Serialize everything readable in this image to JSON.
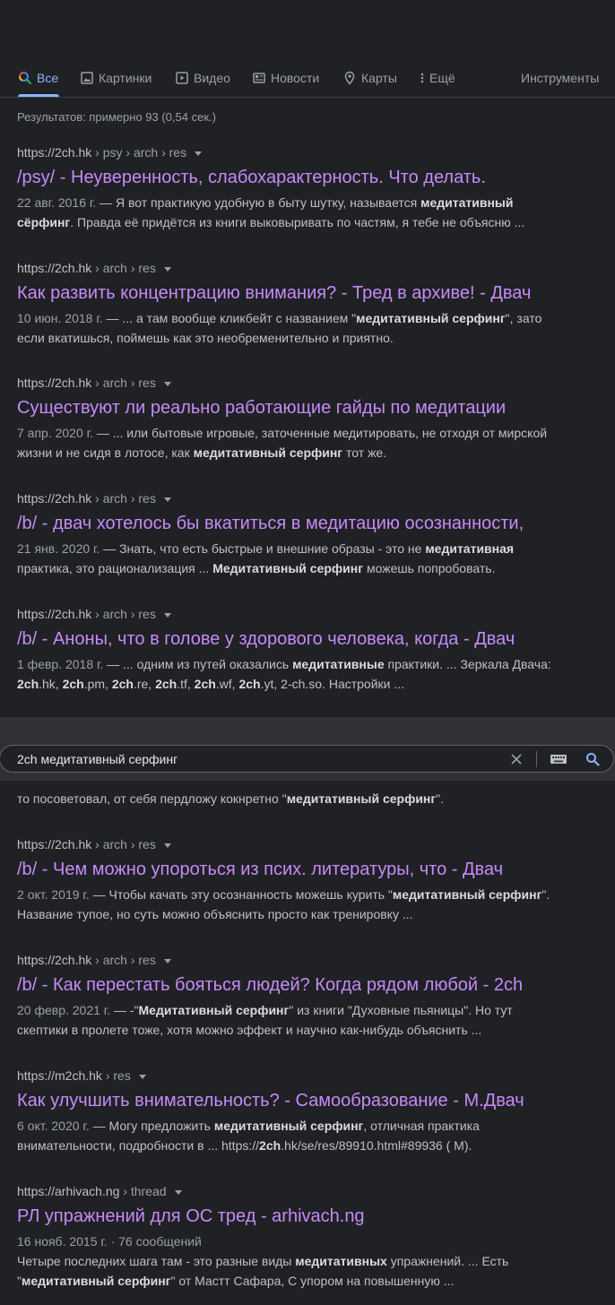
{
  "tabs": {
    "all": "Все",
    "images": "Картинки",
    "video": "Видео",
    "news": "Новости",
    "maps": "Карты",
    "more": "Ещё",
    "tools": "Инструменты"
  },
  "stats": "Результатов: примерно 93 (0,54 сек.)",
  "results": [
    {
      "site": "https://2ch.hk",
      "crumbs": " › psy › arch › res",
      "title": "/psy/ - Неуверенность, слабохарактерность. Что делать.",
      "date": "22 авг. 2016 г.",
      "s1": " — Я вот практикую удобную в быту шутку, называется ",
      "b1": "медитативный сёрфинг",
      "s2": ". Правда её придётся из книги выковыривать по частям, я тебе не объясню ..."
    },
    {
      "site": "https://2ch.hk",
      "crumbs": " › arch › res",
      "title": "Как развить концентрацию внимания? - Тред в архиве! - Двач",
      "date": "10 июн. 2018 г.",
      "s1": " — ... а там вообще кликбейт с названием \"",
      "b1": "медитативный серфинг",
      "s2": "\", зато если вкатишься, поймешь как это необременительно и приятно."
    },
    {
      "site": "https://2ch.hk",
      "crumbs": " › arch › res",
      "title": "Существуют ли реально работающие гайды по медитации",
      "date": "7 апр. 2020 г.",
      "s1": " — ... или бытовые игровые, заточенные медитировать, не отходя от мирской жизни и не сидя в лотосе, как ",
      "b1": "медитативный серфинг",
      "s2": " тот же."
    },
    {
      "site": "https://2ch.hk",
      "crumbs": " › arch › res",
      "title": "/b/ - двач хотелось бы вкатиться в медитацию осознанности,",
      "date": "21 янв. 2020 г.",
      "s1": " — Знать, что есть быстрые и внешние образы - это не ",
      "b1": "медитативная",
      "s2": " практика, это рационализация ... ",
      "b2": "Медитативный серфинг",
      "s3": " можешь попробовать."
    },
    {
      "site": "https://2ch.hk",
      "crumbs": " › arch › res",
      "title": "/b/ - Аноны, что в голове у здорового человека, когда - Двач",
      "date": "1 февр. 2018 г.",
      "s1": " — ... одним из путей оказались ",
      "b1": "медитативные",
      "s2": " практики. ... Зеркала Двача: ",
      "b2": "2ch",
      "s3": ".hk, ",
      "b3": "2ch",
      "s4": ".pm, ",
      "b4": "2ch",
      "s5": ".re, ",
      "b5": "2ch",
      "s6": ".tf, ",
      "b6": "2ch",
      "s7": ".wf, ",
      "b7": "2ch",
      "s8": ".yt, 2-ch.so. Настройки ..."
    },
    {
      "site": "https://2ch.hk",
      "crumbs": " › arch › res",
      "title": "/b/ - Чем можно упороться из псих. литературы, что - Двач",
      "date": "2 окт. 2019 г.",
      "s1": " — Чтобы качать эту осознанность можешь курить \"",
      "b1": "медитативный серфинг",
      "s2": "\". Название тупое, но суть можно объяснить просто как тренировку ..."
    },
    {
      "site": "https://2ch.hk",
      "crumbs": " › arch › res",
      "title": "/b/ - Как перестать бояться людей? Когда рядом любой - 2ch",
      "date": "20 февр. 2021 г.",
      "s1": " — -\"",
      "b1": "Медитативный серфинг",
      "s2": "\" из книги \"Духовные пьяницы\". Но тут скептики в пролете тоже, хотя можно эффект и научно как-нибудь объяснить ..."
    },
    {
      "site": "https://m2ch.hk",
      "crumbs": " › res",
      "title": "Как улучшить внимательность? - Самообразование - М.Двач",
      "date": "6 окт. 2020 г.",
      "s1": " — Могу предложить ",
      "b1": "медитативный серфинг",
      "s2": ", отличная практика внимательности, подробности в ... https://",
      "b2": "2ch",
      "s3": ".hk/se/res/89910.html#89936 ( M)."
    },
    {
      "site": "https://arhivach.ng",
      "crumbs": " › thread",
      "title": "РЛ упражнений для ОС тред - arhivach.ng",
      "meta": "16 нояб. 2015 г. · 76 сообщений",
      "s1": "Четыре последних шага там - это разные виды ",
      "b1": "медитативных",
      "s2": " упражнений. ... Есть \"",
      "b2": "медитативный серфинг",
      "s3": "\" от Мастт Сафара, С упором на повышенную ..."
    }
  ],
  "covered": {
    "s1": "то посоветовал, от себя пердложу кокнретно \"",
    "b1": "медитативный серфинг",
    "s2": "\"."
  },
  "search": {
    "query": "2ch медитативный серфинг"
  }
}
